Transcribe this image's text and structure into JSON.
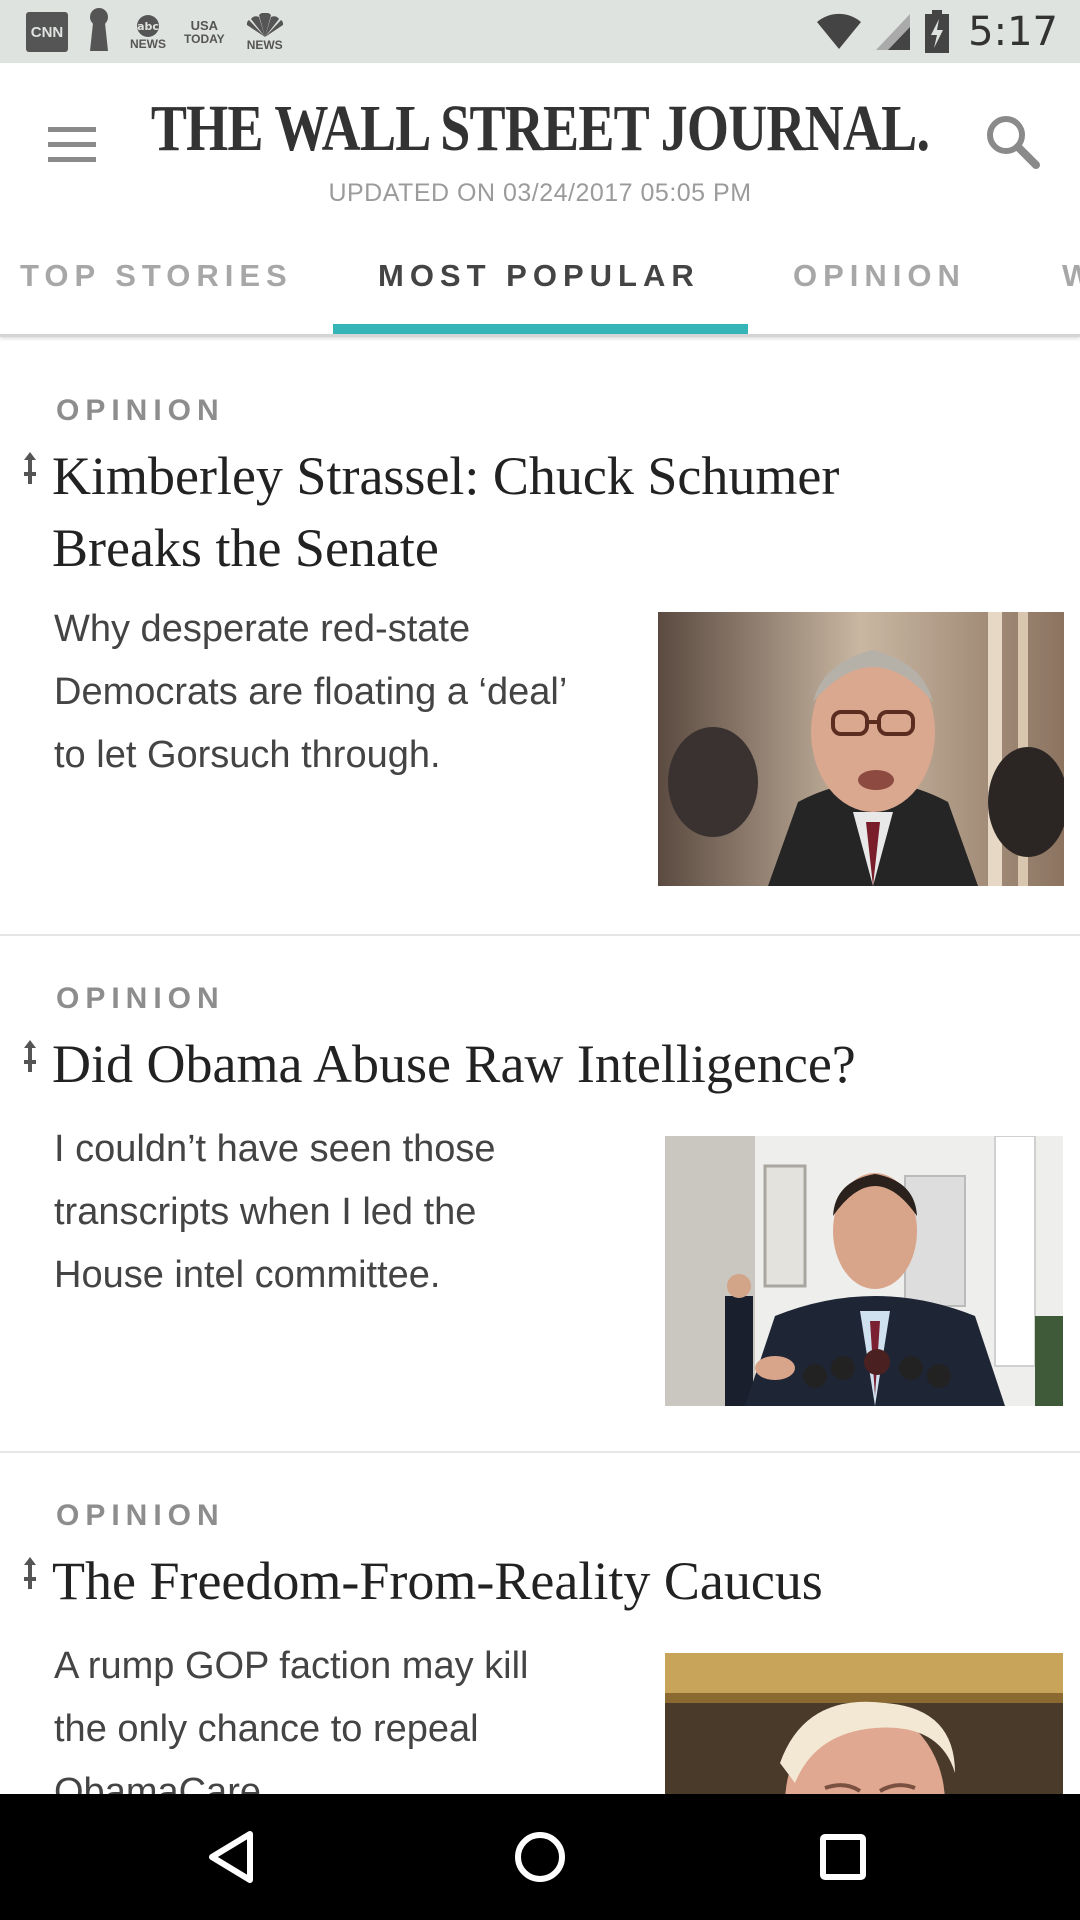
{
  "status_bar": {
    "time": "5:17",
    "notifications": [
      {
        "name": "cnn-icon",
        "text": "CNN"
      },
      {
        "name": "keyhole-icon",
        "text": ""
      },
      {
        "name": "abc-news-icon",
        "top": "abc",
        "bottom": "NEWS"
      },
      {
        "name": "usa-today-icon",
        "top": "USA",
        "bottom": "TODAY"
      },
      {
        "name": "nbc-news-icon",
        "top": "",
        "bottom": "NEWS"
      }
    ],
    "icons": [
      "wifi-icon",
      "signal-icon",
      "battery-charging-icon"
    ]
  },
  "header": {
    "masthead": "THE WALL STREET JOURNAL.",
    "updated": "UPDATED ON 03/24/2017 05:05 PM",
    "menu_icon": "hamburger-menu-icon",
    "search_icon": "search-icon"
  },
  "tabs": [
    {
      "label": "TOP STORIES",
      "active": false
    },
    {
      "label": "MOST POPULAR",
      "active": true
    },
    {
      "label": "OPINION",
      "active": false
    },
    {
      "label": "W",
      "active": false
    }
  ],
  "accent_color": "#36b5b9",
  "articles": [
    {
      "kicker": "OPINION",
      "headline_lines": [
        "Kimberley Strassel: Chuck Schumer",
        "Breaks the Senate"
      ],
      "summary_lines": [
        "Why desperate red-state",
        "Democrats are floating a ‘deal’",
        "to let Gorsuch through."
      ],
      "thumbnail": "photo of Chuck Schumer speaking"
    },
    {
      "kicker": "OPINION",
      "headline_lines": [
        "Did Obama Abuse Raw Intelligence?"
      ],
      "summary_lines": [
        "I couldn’t have seen those",
        "transcripts when I led the",
        "House intel committee."
      ],
      "thumbnail": "photo of man speaking at microphones outside White House"
    },
    {
      "kicker": "OPINION",
      "headline_lines": [
        "The Freedom-From-Reality Caucus"
      ],
      "summary_lines": [
        "A rump GOP faction may kill",
        "the only chance to repeal",
        "ObamaCare."
      ],
      "thumbnail": "photo of Donald Trump"
    }
  ],
  "nav_bar": {
    "back": "back-triangle-icon",
    "home": "home-circle-icon",
    "recents": "recents-square-icon"
  }
}
